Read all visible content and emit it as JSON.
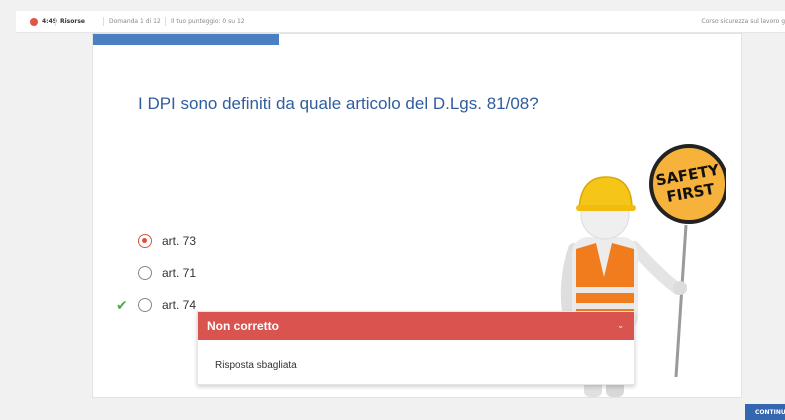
{
  "topbar": {
    "time": "4:49",
    "resources": "Risorse",
    "question_counter": "Domanda 1 di 12",
    "score": "Il tuo punteggio: 0 su 12",
    "course": "Corso sicurezza sul lavoro g"
  },
  "quiz": {
    "question": "I DPI sono definiti da quale articolo del D.Lgs. 81/08?",
    "options": [
      {
        "label": "art. 73",
        "selected": true
      },
      {
        "label": "art. 71",
        "selected": false
      },
      {
        "label": "art. 74",
        "selected": false,
        "correct": true
      }
    ]
  },
  "illustration": {
    "sign_line1": "SAFETY",
    "sign_line2": "FIRST"
  },
  "feedback": {
    "title": "Non corretto",
    "message": "Risposta sbagliata"
  },
  "footer": {
    "continue_label": "CONTINU"
  },
  "colors": {
    "accent_blue": "#2f5d9e",
    "error_red": "#d9534f",
    "correct_green": "#4cae4c",
    "helmet_yellow": "#f5c518",
    "vest_orange": "#f07c1e"
  }
}
